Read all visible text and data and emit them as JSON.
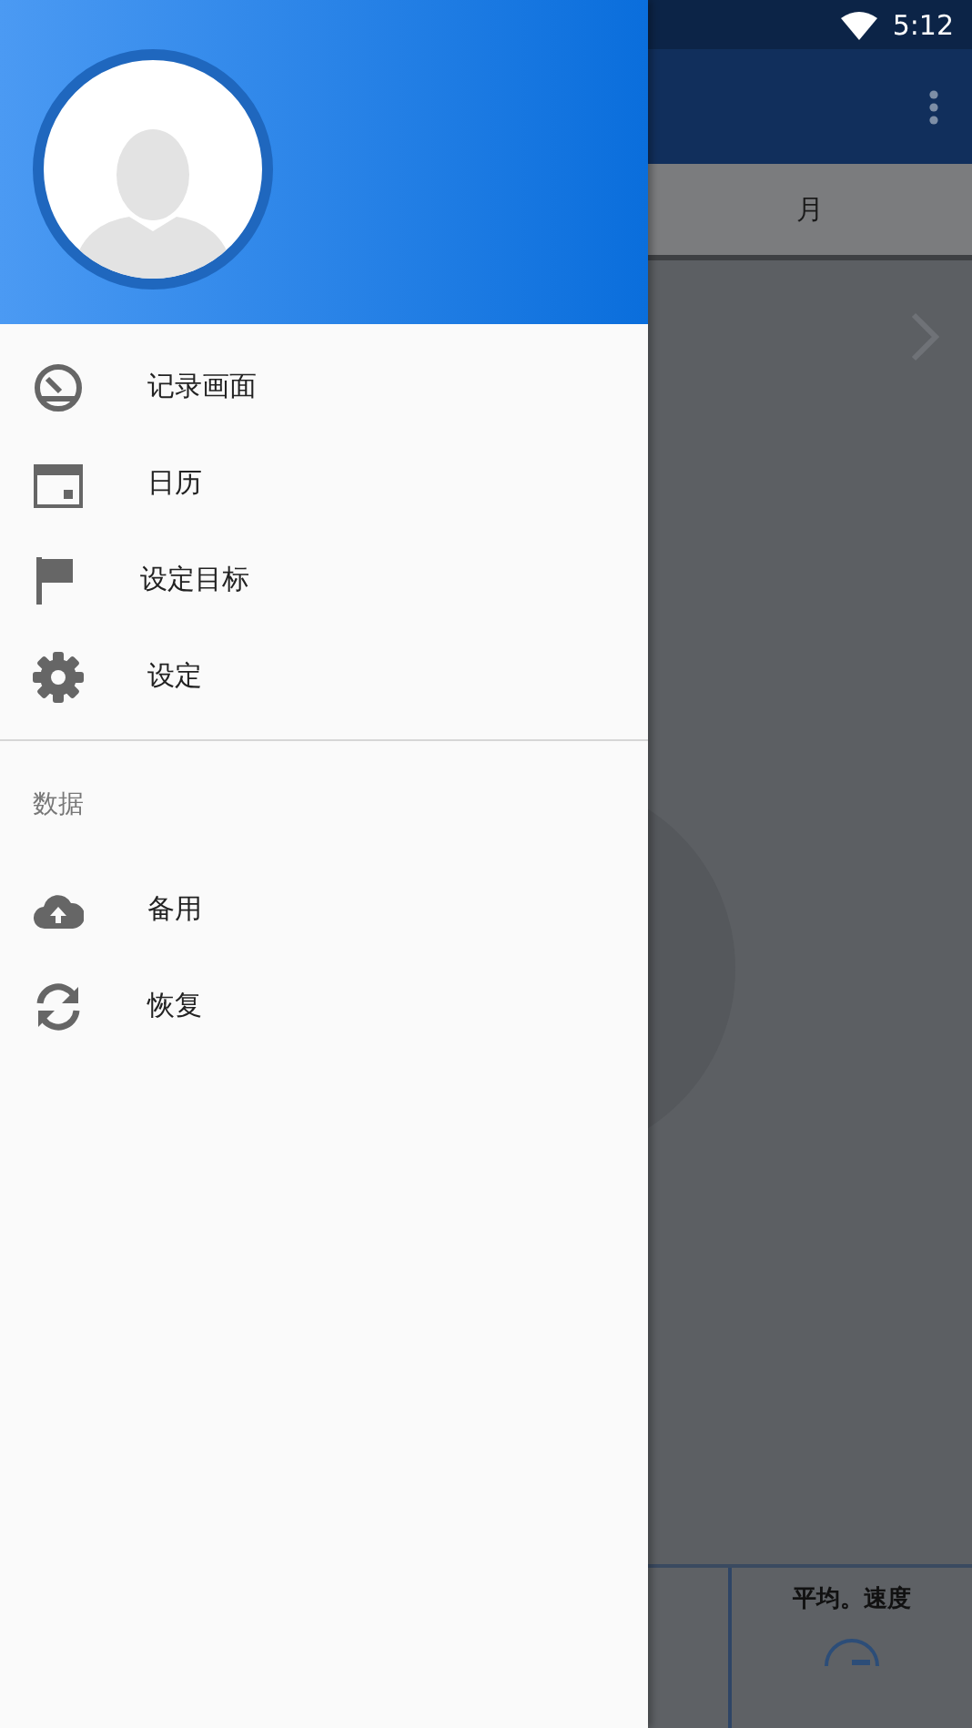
{
  "status_bar": {
    "time": "5:12"
  },
  "app": {
    "tab": "月",
    "bottom_card": "平均。速度"
  },
  "drawer": {
    "sections": [
      {
        "items": [
          {
            "label": "记录画面"
          },
          {
            "label": "日历"
          },
          {
            "label": "设定目标"
          },
          {
            "label": "设定"
          }
        ]
      },
      {
        "title": "数据",
        "items": [
          {
            "label": "备用"
          },
          {
            "label": "恢复"
          }
        ]
      }
    ]
  }
}
